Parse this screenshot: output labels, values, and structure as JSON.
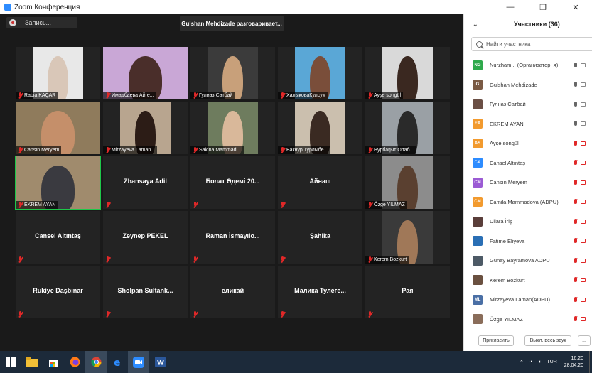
{
  "window": {
    "title": "Zoom Конференция",
    "minimize": "—",
    "restore": "❐",
    "close": "✕"
  },
  "recording_label": "Запись...",
  "speaker_banner": "Gulshan Mehdizade разговаривает...",
  "grid": [
    {
      "name": "Rabia KAÇAR",
      "label_style": "tag",
      "video": true
    },
    {
      "name": "Имадбаева Айге...",
      "label_style": "tag",
      "video": true
    },
    {
      "name": "Гулназ Сатбай",
      "label_style": "tag",
      "video": true
    },
    {
      "name": "ХалыковаКулсум",
      "label_style": "tag",
      "video": true
    },
    {
      "name": "Ayşe songül",
      "label_style": "tag",
      "video": true
    },
    {
      "name": "Cansın Meryem",
      "label_style": "tag",
      "video": true
    },
    {
      "name": "Mirzayeva Laman...",
      "label_style": "tag",
      "video": true
    },
    {
      "name": "Sakina Mammadl...",
      "label_style": "tag",
      "video": true
    },
    {
      "name": "Бакнур Турлыбе...",
      "label_style": "tag",
      "video": true
    },
    {
      "name": "Нурбақыт Опаб...",
      "label_style": "tag",
      "video": true
    },
    {
      "name": "EKREM AYAN",
      "label_style": "tag",
      "video": true,
      "active": true
    },
    {
      "name": "Zhansaya Adil",
      "label_style": "center",
      "video": false
    },
    {
      "name": "Болат Әдемі 20...",
      "label_style": "center",
      "video": false
    },
    {
      "name": "Айнаш",
      "label_style": "center",
      "video": false
    },
    {
      "name": "Özge YILMAZ",
      "label_style": "tag",
      "video": true
    },
    {
      "name": "Cansel Altıntaş",
      "label_style": "center",
      "video": false
    },
    {
      "name": "Zeynep PEKEL",
      "label_style": "center",
      "video": false
    },
    {
      "name": "Raman İsmayılo...",
      "label_style": "center",
      "video": false
    },
    {
      "name": "Şahika",
      "label_style": "center",
      "video": false
    },
    {
      "name": "Kerem Bozkurt",
      "label_style": "tag",
      "video": true
    },
    {
      "name": "Rukiye Daşbınar",
      "label_style": "center",
      "video": false
    },
    {
      "name": "Sholpan Sultank...",
      "label_style": "center",
      "video": false
    },
    {
      "name": "еликай",
      "label_style": "center",
      "video": false
    },
    {
      "name": "Малика Тулеге...",
      "label_style": "center",
      "video": false
    },
    {
      "name": "Рая",
      "label_style": "center",
      "video": false
    }
  ],
  "participants_panel": {
    "title": "Участники (36)",
    "search_placeholder": "Найти участника",
    "participants": [
      {
        "initials": "NG",
        "color": "#2ea94b",
        "name": "Nurzham... (Организатор, я)",
        "mic": "on"
      },
      {
        "initials": "G",
        "color": "#7a5a44",
        "name": "Gulshan Mehdizade",
        "mic": "on"
      },
      {
        "initials": "",
        "color": "#6b4f45",
        "name": "Гулназ Сатбай",
        "mic": "on"
      },
      {
        "initials": "EA",
        "color": "#f29a2e",
        "name": "EKREM AYAN",
        "mic": "on"
      },
      {
        "initials": "AS",
        "color": "#f29a2e",
        "name": "Ayşe songül",
        "mic": "muted"
      },
      {
        "initials": "CA",
        "color": "#2d8cff",
        "name": "Cansel Altıntaş",
        "mic": "muted"
      },
      {
        "initials": "CM",
        "color": "#9b5bd4",
        "name": "Cansın Meryem",
        "mic": "muted"
      },
      {
        "initials": "CM",
        "color": "#f29a2e",
        "name": "Camila Mammadova (ADPU)",
        "mic": "muted"
      },
      {
        "initials": "",
        "color": "#5a3e3a",
        "name": "Dilara İriş",
        "mic": "muted"
      },
      {
        "initials": "",
        "color": "#2a6fb5",
        "name": "Fatime Eliyeva",
        "mic": "muted"
      },
      {
        "initials": "",
        "color": "#4d5a66",
        "name": "Günay Bayramova ADPU",
        "mic": "muted"
      },
      {
        "initials": "",
        "color": "#6a5040",
        "name": "Kerem Bozkurt",
        "mic": "muted"
      },
      {
        "initials": "ML",
        "color": "#4a6fa5",
        "name": "Mirzayeva Laman(ADPU)",
        "mic": "muted"
      },
      {
        "initials": "",
        "color": "#8a6d5a",
        "name": "Özge YILMAZ",
        "mic": "muted"
      }
    ],
    "footer": {
      "invite": "Пригласить",
      "mute_all": "Выкл. весь звук",
      "more": "..."
    }
  },
  "taskbar": {
    "icons": [
      "windows-start-icon",
      "search-icon",
      "file-explorer-icon",
      "store-icon",
      "firefox-icon",
      "chrome-icon",
      "edge-icon",
      "zoom-icon",
      "word-icon"
    ],
    "language": "TUR",
    "time": "16:20",
    "date": "28.04.20"
  }
}
